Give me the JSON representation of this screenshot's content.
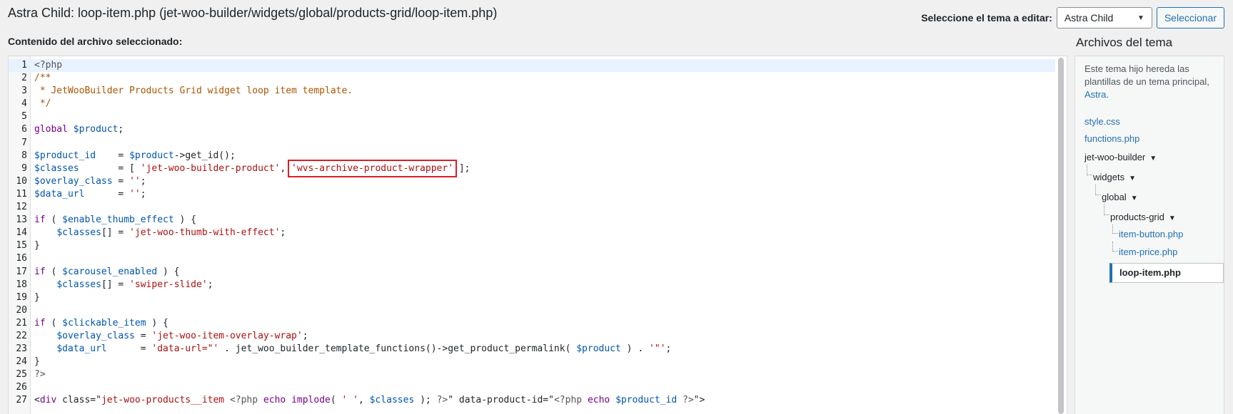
{
  "header": {
    "title": "Astra Child: loop-item.php (jet-woo-builder/widgets/global/products-grid/loop-item.php)",
    "theme_label": "Seleccione el tema a editar:",
    "theme_value": "Astra Child",
    "select_button": "Seleccionar"
  },
  "content_label": "Contenido del archivo seleccionado:",
  "editor": {
    "lines": [
      {
        "n": "1",
        "t": [
          {
            "c": "meta",
            "v": "<?php"
          }
        ]
      },
      {
        "n": "2",
        "t": [
          {
            "c": "cm",
            "v": "/**"
          }
        ]
      },
      {
        "n": "3",
        "t": [
          {
            "c": "cm",
            "v": " * JetWooBuilder Products Grid widget loop item template."
          }
        ]
      },
      {
        "n": "4",
        "t": [
          {
            "c": "cm",
            "v": " */"
          }
        ]
      },
      {
        "n": "5",
        "t": []
      },
      {
        "n": "6",
        "t": [
          {
            "c": "kw",
            "v": "global"
          },
          {
            "c": "op",
            "v": " "
          },
          {
            "c": "var",
            "v": "$product"
          },
          {
            "c": "op",
            "v": ";"
          }
        ]
      },
      {
        "n": "7",
        "t": []
      },
      {
        "n": "8",
        "t": [
          {
            "c": "var",
            "v": "$product_id"
          },
          {
            "c": "op",
            "v": "    = "
          },
          {
            "c": "var",
            "v": "$product"
          },
          {
            "c": "op",
            "v": "->get_id();"
          }
        ]
      },
      {
        "n": "9",
        "t": [
          {
            "c": "var",
            "v": "$classes"
          },
          {
            "c": "op",
            "v": "       = [ "
          },
          {
            "c": "str",
            "v": "'jet-woo-builder-product'"
          },
          {
            "c": "op",
            "v": ", "
          },
          {
            "c": "strhl",
            "v": "'wvs-archive-product-wrapper'"
          },
          {
            "c": "op",
            "v": " ];"
          }
        ]
      },
      {
        "n": "10",
        "t": [
          {
            "c": "var",
            "v": "$overlay_class"
          },
          {
            "c": "op",
            "v": " = "
          },
          {
            "c": "str",
            "v": "''"
          },
          {
            "c": "op",
            "v": ";"
          }
        ]
      },
      {
        "n": "11",
        "t": [
          {
            "c": "var",
            "v": "$data_url"
          },
          {
            "c": "op",
            "v": "      = "
          },
          {
            "c": "str",
            "v": "''"
          },
          {
            "c": "op",
            "v": ";"
          }
        ]
      },
      {
        "n": "12",
        "t": []
      },
      {
        "n": "13",
        "t": [
          {
            "c": "kw",
            "v": "if"
          },
          {
            "c": "op",
            "v": " ( "
          },
          {
            "c": "var",
            "v": "$enable_thumb_effect"
          },
          {
            "c": "op",
            "v": " ) {"
          }
        ]
      },
      {
        "n": "14",
        "t": [
          {
            "c": "op",
            "v": "    "
          },
          {
            "c": "var",
            "v": "$classes"
          },
          {
            "c": "op",
            "v": "[] = "
          },
          {
            "c": "str",
            "v": "'jet-woo-thumb-with-effect'"
          },
          {
            "c": "op",
            "v": ";"
          }
        ]
      },
      {
        "n": "15",
        "t": [
          {
            "c": "op",
            "v": "}"
          }
        ]
      },
      {
        "n": "16",
        "t": []
      },
      {
        "n": "17",
        "t": [
          {
            "c": "kw",
            "v": "if"
          },
          {
            "c": "op",
            "v": " ( "
          },
          {
            "c": "var",
            "v": "$carousel_enabled"
          },
          {
            "c": "op",
            "v": " ) {"
          }
        ]
      },
      {
        "n": "18",
        "t": [
          {
            "c": "op",
            "v": "    "
          },
          {
            "c": "var",
            "v": "$classes"
          },
          {
            "c": "op",
            "v": "[] = "
          },
          {
            "c": "str",
            "v": "'swiper-slide'"
          },
          {
            "c": "op",
            "v": ";"
          }
        ]
      },
      {
        "n": "19",
        "t": [
          {
            "c": "op",
            "v": "}"
          }
        ]
      },
      {
        "n": "20",
        "t": []
      },
      {
        "n": "21",
        "t": [
          {
            "c": "kw",
            "v": "if"
          },
          {
            "c": "op",
            "v": " ( "
          },
          {
            "c": "var",
            "v": "$clickable_item"
          },
          {
            "c": "op",
            "v": " ) {"
          }
        ]
      },
      {
        "n": "22",
        "t": [
          {
            "c": "op",
            "v": "    "
          },
          {
            "c": "var",
            "v": "$overlay_class"
          },
          {
            "c": "op",
            "v": " = "
          },
          {
            "c": "str",
            "v": "'jet-woo-item-overlay-wrap'"
          },
          {
            "c": "op",
            "v": ";"
          }
        ]
      },
      {
        "n": "23",
        "t": [
          {
            "c": "op",
            "v": "    "
          },
          {
            "c": "var",
            "v": "$data_url"
          },
          {
            "c": "op",
            "v": "      = "
          },
          {
            "c": "str",
            "v": "'data-url=\"'"
          },
          {
            "c": "op",
            "v": " . jet_woo_builder_template_functions()->get_product_permalink( "
          },
          {
            "c": "var",
            "v": "$product"
          },
          {
            "c": "op",
            "v": " ) . "
          },
          {
            "c": "str",
            "v": "'\"'"
          },
          {
            "c": "op",
            "v": ";"
          }
        ]
      },
      {
        "n": "24",
        "t": [
          {
            "c": "op",
            "v": "}"
          }
        ]
      },
      {
        "n": "25",
        "t": [
          {
            "c": "meta",
            "v": "?>"
          }
        ]
      },
      {
        "n": "26",
        "t": []
      },
      {
        "n": "27",
        "t": [
          {
            "c": "op",
            "v": "<"
          },
          {
            "c": "kw",
            "v": "div"
          },
          {
            "c": "op",
            "v": " class=\""
          },
          {
            "c": "str",
            "v": "jet-woo-products__item "
          },
          {
            "c": "meta",
            "v": "<?php "
          },
          {
            "c": "kw",
            "v": "echo"
          },
          {
            "c": "op",
            "v": " "
          },
          {
            "c": "kw",
            "v": "implode"
          },
          {
            "c": "op",
            "v": "( "
          },
          {
            "c": "str",
            "v": "' '"
          },
          {
            "c": "op",
            "v": ", "
          },
          {
            "c": "var",
            "v": "$classes"
          },
          {
            "c": "op",
            "v": " ); "
          },
          {
            "c": "meta",
            "v": "?>"
          },
          {
            "c": "op",
            "v": "\" data-product-id=\""
          },
          {
            "c": "meta",
            "v": "<?php "
          },
          {
            "c": "kw",
            "v": "echo"
          },
          {
            "c": "op",
            "v": " "
          },
          {
            "c": "var",
            "v": "$product_id"
          },
          {
            "c": "op",
            "v": " "
          },
          {
            "c": "meta",
            "v": "?>"
          },
          {
            "c": "op",
            "v": "\">"
          }
        ]
      }
    ]
  },
  "sidebar": {
    "title": "Archivos del tema",
    "desc_prefix": "Este tema hijo hereda las plantillas de un tema principal, ",
    "desc_link": "Astra",
    "desc_suffix": ".",
    "files": {
      "style": "style.css",
      "functions": "functions.php",
      "dir1": "jet-woo-builder",
      "dir2": "widgets",
      "dir3": "global",
      "dir4": "products-grid",
      "f1": "item-button.php",
      "f2": "item-price.php",
      "current": "loop-item.php"
    }
  }
}
